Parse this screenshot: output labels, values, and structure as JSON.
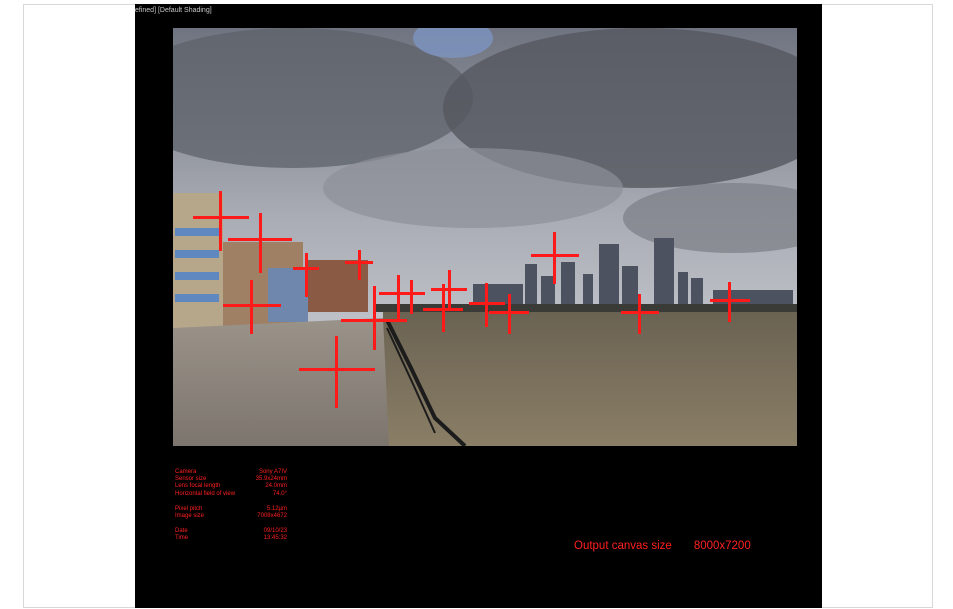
{
  "viewport": {
    "title": "efined] [Default Shading]"
  },
  "metadata": [
    {
      "label": "Camera",
      "value": "Sony A7IV"
    },
    {
      "label": "Sensor size",
      "value": "35.9x24mm"
    },
    {
      "label": "Lens focal length",
      "value": "24.0mm"
    },
    {
      "label": "Horizontal field of view",
      "value": "74.0°"
    },
    {
      "label": "Pixel pitch",
      "value": "5.12µm"
    },
    {
      "label": "Image size",
      "value": "7008x4672"
    },
    {
      "label": "Date",
      "value": "09/10/23"
    },
    {
      "label": "Time",
      "value": "13:45:32"
    }
  ],
  "output": {
    "label": "Output canvas size",
    "value": "8000x7200"
  },
  "control_points_color": "#ff1a1a",
  "control_points_count": 17
}
